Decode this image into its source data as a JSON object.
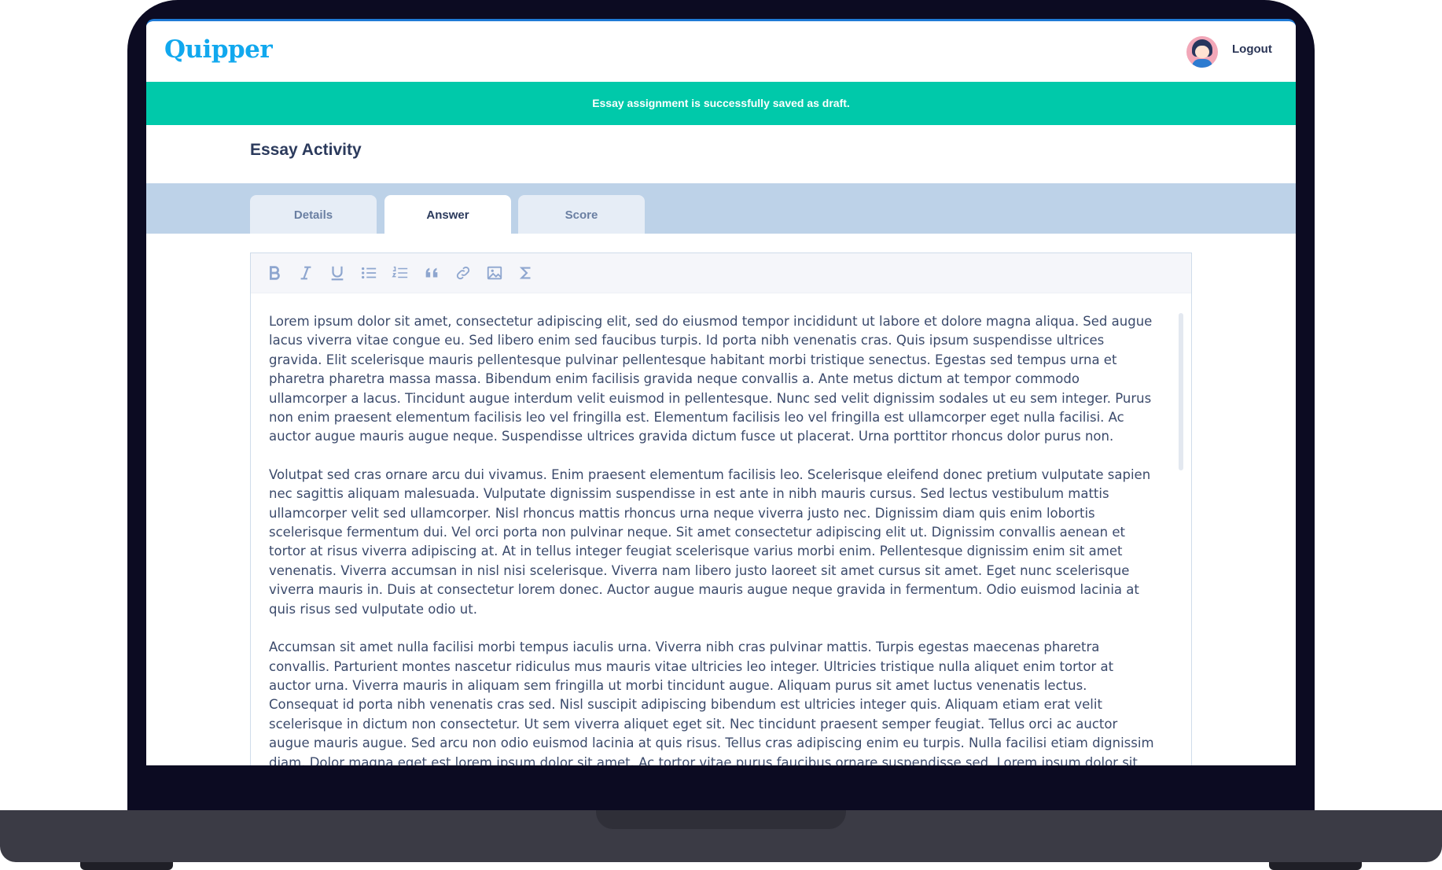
{
  "app": {
    "logo": "Quipper",
    "logout_label": "Logout"
  },
  "banner": {
    "message": "Essay assignment is successfully saved as draft."
  },
  "page": {
    "title": "Essay Activity"
  },
  "tabs": [
    {
      "label": "Details",
      "active": false
    },
    {
      "label": "Answer",
      "active": true
    },
    {
      "label": "Score",
      "active": false
    }
  ],
  "toolbar": {
    "tools": [
      "bold-icon",
      "italic-icon",
      "underline-icon",
      "bulleted-list-icon",
      "numbered-list-icon",
      "quote-icon",
      "link-icon",
      "image-icon",
      "sigma-icon"
    ]
  },
  "editor": {
    "paragraphs": [
      "Lorem ipsum dolor sit amet, consectetur adipiscing elit, sed do eiusmod tempor incididunt ut labore et dolore magna aliqua. Sed augue lacus viverra vitae congue eu. Sed libero enim sed faucibus turpis. Id porta nibh venenatis cras. Quis ipsum suspendisse ultrices gravida. Elit scelerisque mauris pellentesque pulvinar pellentesque habitant morbi tristique senectus. Egestas sed tempus urna et pharetra pharetra massa massa. Bibendum enim facilisis gravida neque convallis a. Ante metus dictum at tempor commodo ullamcorper a lacus. Tincidunt augue interdum velit euismod in pellentesque. Nunc sed velit dignissim sodales ut eu sem integer. Purus non enim praesent elementum facilisis leo vel fringilla est. Elementum facilisis leo vel fringilla est ullamcorper eget nulla facilisi. Ac auctor augue mauris augue neque. Suspendisse ultrices gravida dictum fusce ut placerat. Urna porttitor rhoncus dolor purus non.",
      "Volutpat sed cras ornare arcu dui vivamus. Enim praesent elementum facilisis leo. Scelerisque eleifend donec pretium vulputate sapien nec sagittis aliquam malesuada. Vulputate dignissim suspendisse in est ante in nibh mauris cursus. Sed lectus vestibulum mattis ullamcorper velit sed ullamcorper. Nisl rhoncus mattis rhoncus urna neque viverra justo nec. Dignissim diam quis enim lobortis scelerisque fermentum dui. Vel orci porta non pulvinar neque. Sit amet consectetur adipiscing elit ut. Dignissim convallis aenean et tortor at risus viverra adipiscing at. At in tellus integer feugiat scelerisque varius morbi enim. Pellentesque dignissim enim sit amet venenatis. Viverra accumsan in nisl nisi scelerisque. Viverra nam libero justo laoreet sit amet cursus sit amet. Eget nunc scelerisque viverra mauris in. Duis at consectetur lorem donec. Auctor augue mauris augue neque gravida in fermentum. Odio euismod lacinia at quis risus sed vulputate odio ut.",
      "Accumsan sit amet nulla facilisi morbi tempus iaculis urna. Viverra nibh cras pulvinar mattis. Turpis egestas maecenas pharetra convallis. Parturient montes nascetur ridiculus mus mauris vitae ultricies leo integer. Ultricies tristique nulla aliquet enim tortor at auctor urna. Viverra mauris in aliquam sem fringilla ut morbi tincidunt augue. Aliquam purus sit amet luctus venenatis lectus. Consequat id porta nibh venenatis cras sed. Nisl suscipit adipiscing bibendum est ultricies integer quis. Aliquam etiam erat velit scelerisque in dictum non consectetur. Ut sem viverra aliquet eget sit. Nec tincidunt praesent semper feugiat. Tellus orci ac auctor augue mauris augue. Sed arcu non odio euismod lacinia at quis risus. Tellus cras adipiscing enim eu turpis. Nulla facilisi etiam dignissim diam. Dolor magna eget est lorem ipsum dolor sit amet. Ac tortor vitae purus faucibus ornare suspendisse sed. Lorem ipsum dolor sit amet, consectetur adipiscing elit, sed do eiusmod tempor incididunt ut labore et dolore magna aliqua. Sed augue lacus viverra vitae congue eu. Sed libero enim sed faucibus turpis. Id porta nibh venenatis cras. Quis ipsum suspendisse ultrices gravida. Elit"
    ]
  },
  "colors": {
    "brand": "#11a8ee",
    "banner": "#00c9aa",
    "tabbar": "#bdd2e8",
    "text": "#3b4a6b",
    "accent_bar": "#1f7ad6"
  }
}
